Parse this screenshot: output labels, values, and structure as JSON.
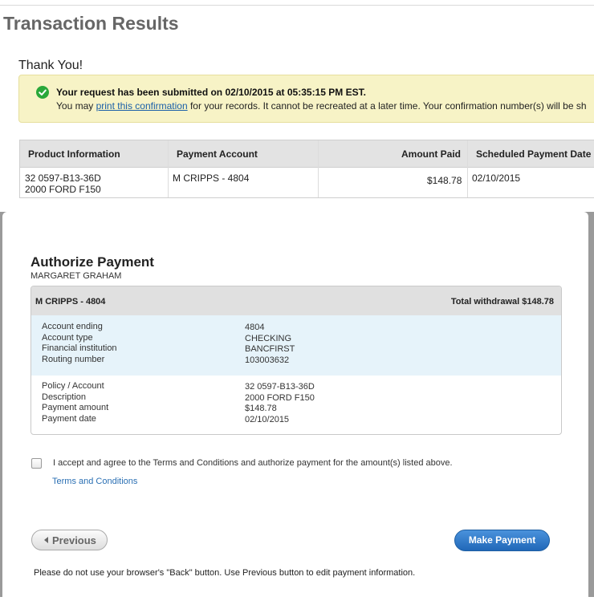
{
  "page": {
    "title": "Transaction Results",
    "thank_you": "Thank You!"
  },
  "notice": {
    "line1": "Your request has been submitted on 02/10/2015 at 05:35:15 PM EST.",
    "line2_prefix": "You may ",
    "print_link": "print this confirmation",
    "line2_suffix": " for your records. It cannot be recreated at a later time. Your confirmation number(s) will be sh",
    "status_color": "#2aa83a"
  },
  "results": {
    "headers": [
      "Product Information",
      "Payment Account",
      "Amount Paid",
      "Scheduled Payment Date"
    ],
    "row": {
      "product_line1": "32 0597-B13-36D",
      "product_line2": "2000 FORD F150",
      "account": "M CRIPPS - 4804",
      "amount": "$148.78",
      "date": "02/10/2015"
    }
  },
  "modal": {
    "title": "Authorize Payment",
    "subtitle": "MARGARET GRAHAM",
    "account_header": "M CRIPPS - 4804",
    "total": "Total withdrawal $148.78",
    "bank_details": [
      {
        "label": "Account ending",
        "value": "4804"
      },
      {
        "label": "Account type",
        "value": "CHECKING"
      },
      {
        "label": "Financial institution",
        "value": "BANCFIRST"
      },
      {
        "label": "Routing number",
        "value": "103003632"
      }
    ],
    "policy_details": [
      {
        "label": "Policy / Account",
        "value": "32 0597-B13-36D"
      },
      {
        "label": "Description",
        "value": "2000 FORD F150"
      },
      {
        "label": "Payment amount",
        "value": "$148.78"
      },
      {
        "label": "Payment date",
        "value": "02/10/2015"
      }
    ],
    "agree_text": "I accept and agree to the Terms and Conditions and authorize payment for the amount(s) listed above.",
    "terms_link": "Terms and Conditions",
    "previous_label": "Previous",
    "make_payment_label": "Make Payment",
    "footnote": "Please do not use your browser's \"Back\" button. Use Previous button to edit payment information."
  }
}
